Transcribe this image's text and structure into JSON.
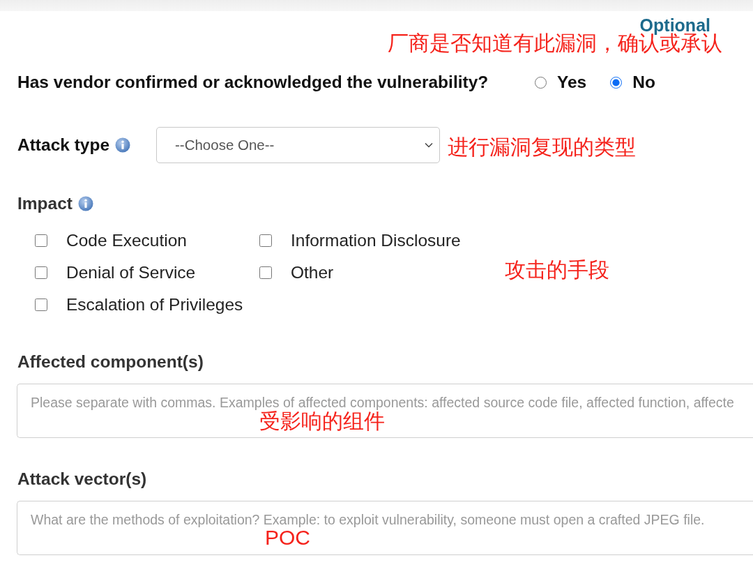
{
  "optional_label": "Optional",
  "vendor_question": {
    "label": "Has vendor confirmed or acknowledged the vulnerability?",
    "options": [
      {
        "label": "Yes",
        "selected": false
      },
      {
        "label": "No",
        "selected": true
      }
    ]
  },
  "attack_type": {
    "label": "Attack type",
    "value": "--Choose One--"
  },
  "impact": {
    "label": "Impact",
    "options": [
      {
        "label": "Code Execution",
        "checked": false
      },
      {
        "label": "Denial of Service",
        "checked": false
      },
      {
        "label": "Escalation of Privileges",
        "checked": false
      },
      {
        "label": "Information Disclosure",
        "checked": false
      },
      {
        "label": "Other",
        "checked": false
      }
    ]
  },
  "affected_components": {
    "label": "Affected component(s)",
    "placeholder": "Please separate with commas. Examples of affected components: affected source code file, affected function, affecte"
  },
  "attack_vectors": {
    "label": "Attack vector(s)",
    "placeholder": "What are the methods of exploitation? Example: to exploit vulnerability, someone must open a crafted JPEG file."
  },
  "annotations": [
    "厂商是否知道有此漏洞，确认或承认",
    "进行漏洞复现的类型",
    "攻击的手段",
    "受影响的组件",
    "POC"
  ]
}
